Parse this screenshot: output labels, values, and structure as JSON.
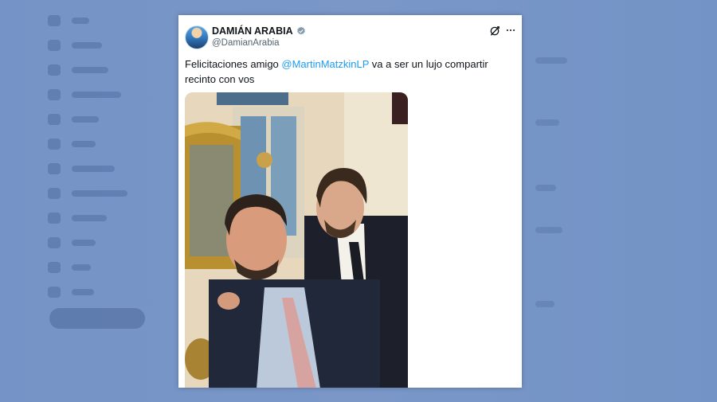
{
  "tweet": {
    "display_name": "DAMIÁN ARABIA",
    "handle": "@DamianArabia",
    "text_before": "Felicitaciones amigo ",
    "mention": "@MartinMatzkinLP",
    "text_after": " va a ser un lujo compartir recinto con vos",
    "verified": true,
    "image_description_icon": "photo-two-men-selfie"
  },
  "icons": {
    "verified": "verified-badge-icon",
    "grok": "grok-icon",
    "more": "more-options-icon"
  },
  "colors": {
    "background": "#7593c6",
    "link": "#1d9bf0",
    "verified_badge": "#829aab"
  }
}
